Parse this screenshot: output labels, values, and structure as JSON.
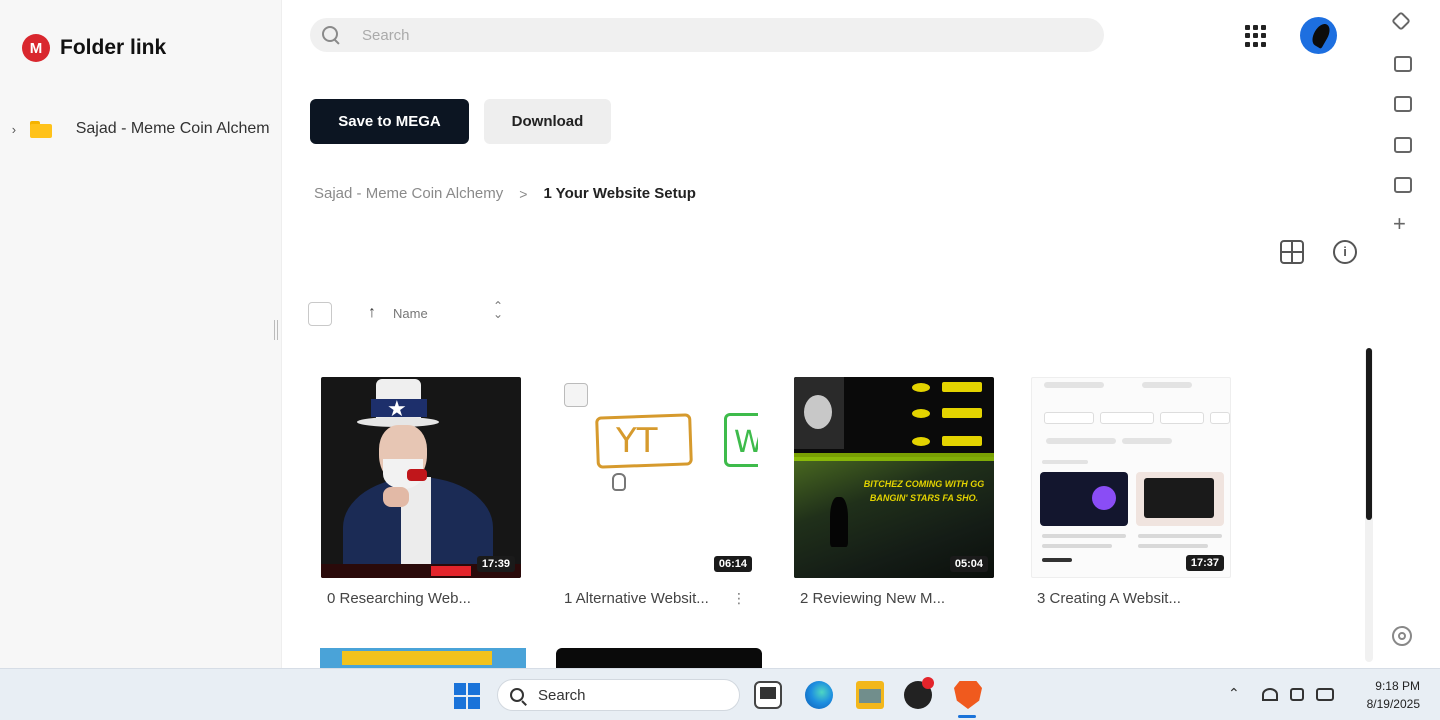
{
  "sidebar": {
    "title": "Folder link",
    "logo_letter": "M",
    "tree": [
      {
        "label": "Sajad - Meme Coin Alchemy"
      }
    ]
  },
  "header": {
    "search_placeholder": "Search"
  },
  "actions": {
    "save_label": "Save to MEGA",
    "download_label": "Download"
  },
  "breadcrumb": {
    "parent": "Sajad - Meme Coin Alchemy",
    "separator": ">",
    "current": "1 Your Website Setup"
  },
  "list_header": {
    "sort_label": "Name",
    "sort_arrow": "↑",
    "sort_toggle": "⌃⌄"
  },
  "thumb_text": {
    "yt": "YT",
    "w": "W",
    "meme_caption": "BITCHEZ COMING WITH GG BANGIN' STARS FA SHO."
  },
  "files": [
    {
      "name": "0 Researching Web...",
      "duration": "17:39"
    },
    {
      "name": "1 Alternative Websit...",
      "duration": "06:14"
    },
    {
      "name": "2 Reviewing New M...",
      "duration": "05:04"
    },
    {
      "name": "3 Creating A Websit...",
      "duration": "17:37"
    }
  ],
  "taskbar": {
    "search_label": "Search",
    "time": "9:18 PM",
    "date": "8/19/2025"
  },
  "colors": {
    "brand_red": "#d9272e",
    "primary_button": "#0c1522",
    "folder_yellow": "#ffc21a"
  }
}
